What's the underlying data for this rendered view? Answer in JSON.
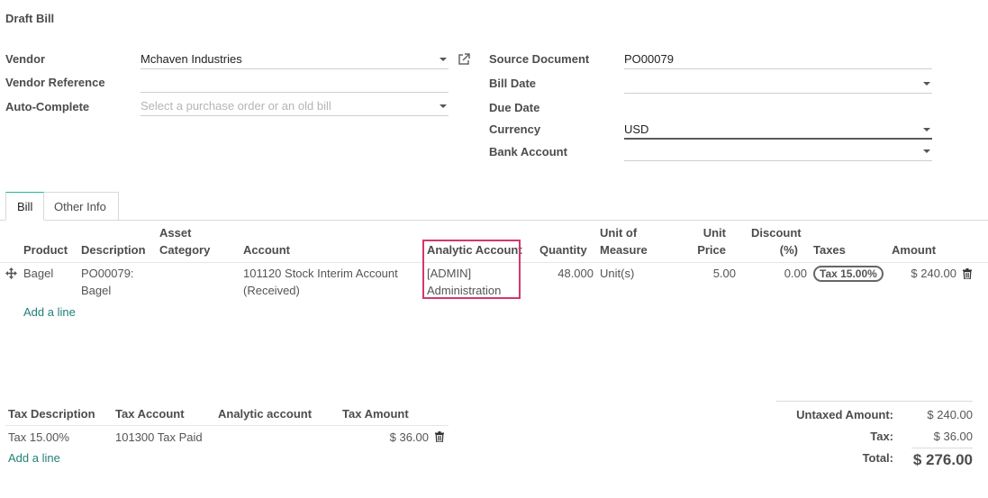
{
  "form": {
    "title": "Draft Bill",
    "left_fields": [
      {
        "label": "Vendor",
        "value": "Mchaven Industries",
        "placeholder": ""
      },
      {
        "label": "Vendor Reference",
        "value": "",
        "placeholder": ""
      },
      {
        "label": "Auto-Complete",
        "value": "",
        "placeholder": "Select a purchase order or an old bill"
      }
    ],
    "right_fields": [
      {
        "label": "Source Document",
        "value": "PO00079"
      },
      {
        "label": "Bill Date",
        "value": ""
      },
      {
        "label": "Due Date",
        "value": ""
      },
      {
        "label": "Currency",
        "value": "USD"
      },
      {
        "label": "Bank Account",
        "value": ""
      }
    ]
  },
  "tabs": [
    {
      "label": "Bill",
      "active": true
    },
    {
      "label": "Other Info",
      "active": false
    }
  ],
  "lines": {
    "headers": {
      "product": "Product",
      "description": "Description",
      "asset_category_1": "Asset",
      "asset_category_2": "Category",
      "account": "Account",
      "analytic_account": "Analytic Account",
      "quantity": "Quantity",
      "uom_1": "Unit of",
      "uom_2": "Measure",
      "unit_price_1": "Unit",
      "unit_price_2": "Price",
      "discount_1": "Discount",
      "discount_2": "(%)",
      "taxes": "Taxes",
      "amount": "Amount"
    },
    "rows": [
      {
        "product": "Bagel",
        "description_1": "PO00079:",
        "description_2": "Bagel",
        "asset_category": "",
        "account_1": "101120 Stock Interim Account",
        "account_2": "(Received)",
        "analytic_1": "[ADMIN]",
        "analytic_2": "Administration",
        "quantity": "48.000",
        "uom": "Unit(s)",
        "unit_price": "5.00",
        "discount": "0.00",
        "tax": "Tax 15.00%",
        "amount": "$ 240.00"
      }
    ],
    "add_line": "Add a line",
    "highlight_color": "#d2386c"
  },
  "tax_table": {
    "headers": {
      "description": "Tax Description",
      "account": "Tax Account",
      "analytic": "Analytic account",
      "amount": "Tax Amount"
    },
    "rows": [
      {
        "description": "Tax 15.00%",
        "account": "101300 Tax Paid",
        "analytic": "",
        "amount": "$ 36.00"
      }
    ],
    "add_line": "Add a line"
  },
  "totals": {
    "untaxed_label": "Untaxed Amount:",
    "untaxed_value": "$ 240.00",
    "tax_label": "Tax:",
    "tax_value": "$ 36.00",
    "total_label": "Total:",
    "total_value": "$ 276.00"
  }
}
